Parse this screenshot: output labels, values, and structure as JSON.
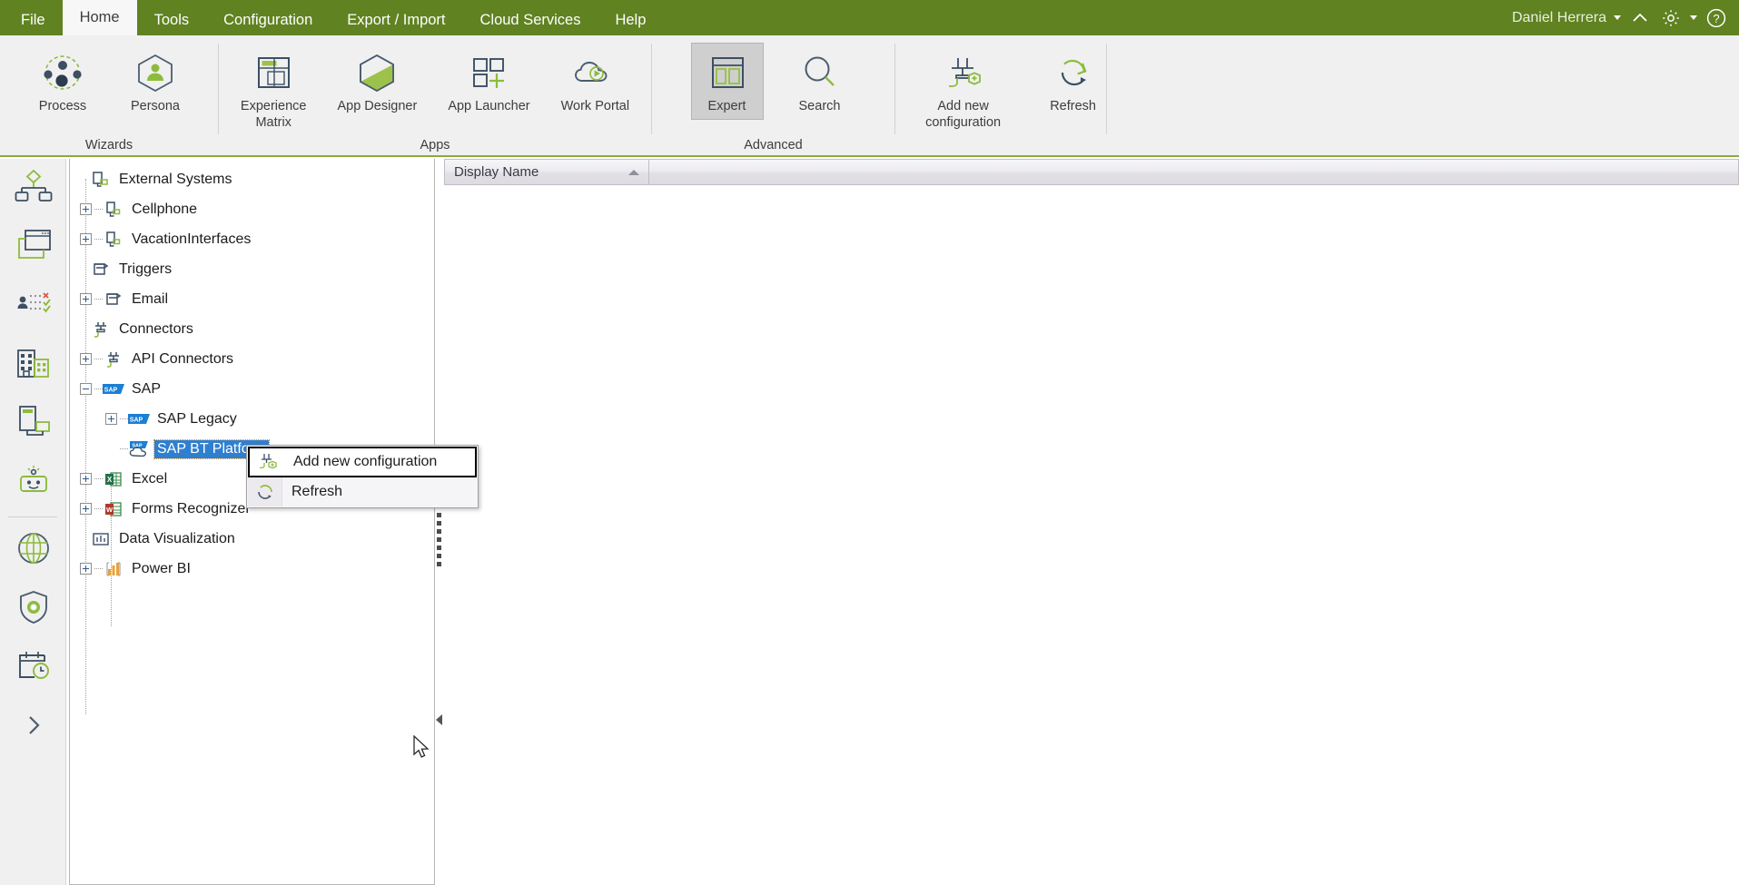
{
  "menubar": {
    "tabs": [
      {
        "label": "File",
        "active": false
      },
      {
        "label": "Home",
        "active": true
      },
      {
        "label": "Tools",
        "active": false
      },
      {
        "label": "Configuration",
        "active": false
      },
      {
        "label": "Export / Import",
        "active": false
      },
      {
        "label": "Cloud Services",
        "active": false
      },
      {
        "label": "Help",
        "active": false
      }
    ],
    "user_name": "Daniel Herrera",
    "user_caret_icon": "chevron-down-icon",
    "collapse_icon": "chevron-up-icon",
    "settings_icon": "gear-icon",
    "settings_caret_icon": "chevron-down-icon",
    "help_icon": "help-circle-icon",
    "background_color": "#608221"
  },
  "ribbon": {
    "groups": [
      {
        "label": "Wizards",
        "buttons": [
          {
            "label": "Process",
            "icon": "process-nodes-icon",
            "toggled": false
          },
          {
            "label": "Persona",
            "icon": "persona-hexagon-icon",
            "toggled": false
          }
        ]
      },
      {
        "label": "Apps",
        "buttons": [
          {
            "label": "Experience\nMatrix",
            "icon": "experience-matrix-icon",
            "toggled": false
          },
          {
            "label": "App Designer",
            "icon": "app-designer-hexagon-icon",
            "toggled": false
          },
          {
            "label": "App Launcher",
            "icon": "app-launcher-grid-icon",
            "toggled": false
          },
          {
            "label": "Work Portal",
            "icon": "cloud-play-icon",
            "toggled": false
          }
        ]
      },
      {
        "label": "Advanced",
        "buttons": [
          {
            "label": "Expert",
            "icon": "expert-panes-icon",
            "toggled": true
          },
          {
            "label": "Search",
            "icon": "search-icon",
            "toggled": false
          }
        ]
      },
      {
        "label": "",
        "buttons": [
          {
            "label": "Add new configuration",
            "icon": "plug-plus-icon",
            "toggled": false
          },
          {
            "label": "Refresh",
            "icon": "refresh-circular-icon",
            "toggled": false
          }
        ]
      }
    ]
  },
  "rail": {
    "items": [
      {
        "icon": "process-flow-icon",
        "name": "processes"
      },
      {
        "icon": "forms-windows-icon",
        "name": "forms"
      },
      {
        "icon": "rules-matrix-icon",
        "name": "rules"
      },
      {
        "icon": "organization-buildings-icon",
        "name": "organization"
      },
      {
        "icon": "devices-icon",
        "name": "devices"
      },
      {
        "icon": "robot-icon",
        "name": "bots"
      },
      {
        "separator": true
      },
      {
        "icon": "globe-icon",
        "name": "integrations"
      },
      {
        "icon": "shield-gear-icon",
        "name": "security"
      },
      {
        "icon": "calendar-clock-icon",
        "name": "scheduler"
      },
      {
        "icon": "chevron-right-icon",
        "name": "expand-rail"
      }
    ]
  },
  "tree": {
    "nodes": [
      {
        "label": "External Systems",
        "icon": "external-systems-icon",
        "indent": 0,
        "expander": "none",
        "selected": false
      },
      {
        "label": "Cellphone",
        "icon": "external-system-icon",
        "indent": 1,
        "expander": "plus",
        "selected": false
      },
      {
        "label": "VacationInterfaces",
        "icon": "external-system-icon",
        "indent": 1,
        "expander": "plus",
        "selected": false
      },
      {
        "label": "Triggers",
        "icon": "trigger-icon",
        "indent": 0,
        "expander": "none",
        "selected": false
      },
      {
        "label": "Email",
        "icon": "trigger-icon",
        "indent": 1,
        "expander": "plus",
        "selected": false
      },
      {
        "label": "Connectors",
        "icon": "connector-plug-icon",
        "indent": 0,
        "expander": "none",
        "selected": false
      },
      {
        "label": "API Connectors",
        "icon": "connector-plug-icon",
        "indent": 1,
        "expander": "plus",
        "selected": false
      },
      {
        "label": "SAP",
        "icon": "sap-icon",
        "indent": 1,
        "expander": "minus",
        "selected": false
      },
      {
        "label": "SAP Legacy",
        "icon": "sap-icon",
        "indent": 2,
        "expander": "plus",
        "selected": false
      },
      {
        "label": "SAP BT Platform",
        "icon": "sap-cloud-icon",
        "indent": 2,
        "expander": "none",
        "selected": true
      },
      {
        "label": "Excel",
        "icon": "excel-icon",
        "indent": 1,
        "expander": "plus",
        "selected": false
      },
      {
        "label": "Forms Recognizer",
        "icon": "word-forms-icon",
        "indent": 1,
        "expander": "plus",
        "selected": false
      },
      {
        "label": "Data Visualization",
        "icon": "chart-bars-icon",
        "indent": 0,
        "expander": "none",
        "selected": false
      },
      {
        "label": "Power BI",
        "icon": "power-bi-icon",
        "indent": 1,
        "expander": "plus",
        "selected": false
      }
    ]
  },
  "context_menu": {
    "items": [
      {
        "label": "Add new configuration",
        "icon": "plug-plus-icon",
        "highlighted": true
      },
      {
        "label": "Refresh",
        "icon": "refresh-circular-icon",
        "highlighted": false
      }
    ]
  },
  "grid": {
    "columns": [
      {
        "label": "Display Name",
        "sort": "asc"
      },
      {
        "label": "",
        "sort": "none"
      }
    ],
    "rows": []
  },
  "splitter": {
    "collapse_icon": "triangle-left-icon",
    "grip_icon": "grip-dots-icon"
  },
  "cursor": {
    "icon": "arrow-pointer-icon"
  }
}
